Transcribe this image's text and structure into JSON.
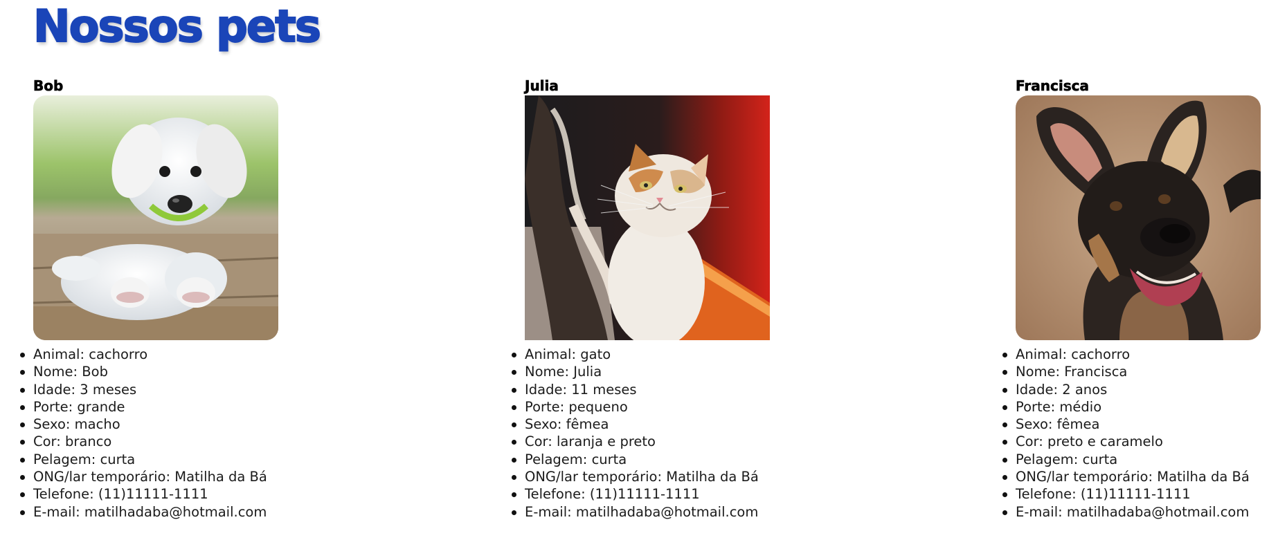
{
  "page": {
    "title": "Nossos pets"
  },
  "pets": [
    {
      "name": "Bob",
      "image_alt": "filhote de cachorro branco",
      "details": [
        "Animal: cachorro",
        "Nome: Bob",
        "Idade: 3 meses",
        "Porte: grande",
        "Sexo: macho",
        "Cor: branco",
        "Pelagem: curta",
        "ONG/lar temporário: Matilha da Bá",
        "Telefone: (11)11111-1111",
        "E-mail: matilhadaba@hotmail.com"
      ]
    },
    {
      "name": "Julia",
      "image_alt": "gata laranja e preta",
      "details": [
        "Animal: gato",
        "Nome: Julia",
        "Idade: 11 meses",
        "Porte: pequeno",
        "Sexo: fêmea",
        "Cor: laranja e preto",
        "Pelagem: curta",
        "ONG/lar temporário: Matilha da Bá",
        "Telefone: (11)11111-1111",
        "E-mail: matilhadaba@hotmail.com"
      ]
    },
    {
      "name": "Francisca",
      "image_alt": "cachorra preta e caramelo",
      "details": [
        "Animal: cachorro",
        "Nome: Francisca",
        "Idade: 2 anos",
        "Porte: médio",
        "Sexo: fêmea",
        "Cor: preto e caramelo",
        "Pelagem: curta",
        "ONG/lar temporário: Matilha da Bá",
        "Telefone: (11)11111-1111",
        "E-mail: matilhadaba@hotmail.com"
      ]
    }
  ],
  "colors": {
    "title": "#1a45b8",
    "text": "#1b1b1b",
    "background": "#ffffff"
  }
}
